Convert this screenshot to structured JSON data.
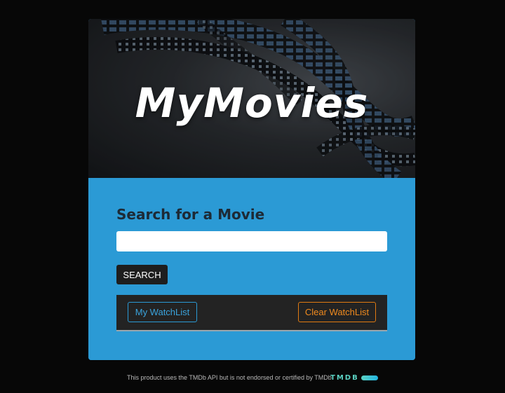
{
  "hero": {
    "title": "MyMovies",
    "image_icon": "film-reel-icon"
  },
  "search": {
    "heading": "Search for a Movie",
    "input_value": "",
    "input_placeholder": "",
    "button_label": "SEARCH"
  },
  "watchlist": {
    "my_watchlist_label": "My WatchList",
    "clear_watchlist_label": "Clear WatchList"
  },
  "footer": {
    "attribution": "This product uses the TMDb API but is not endorsed or certified by TMDb",
    "logo_text": "TMDB"
  },
  "colors": {
    "page_background": "#070707",
    "panel_accent": "#2b9ad5",
    "watchlist_button": "#2b9ad5",
    "clear_button": "#e07a12",
    "search_button": "#1e1e1e",
    "tmdb_brand": "#5bd1c2"
  }
}
